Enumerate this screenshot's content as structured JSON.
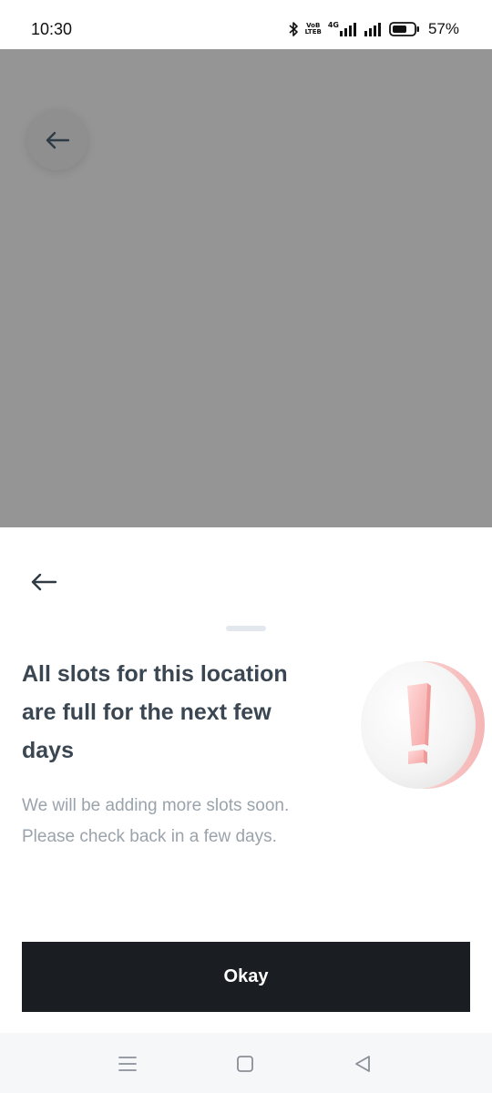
{
  "status_bar": {
    "time": "10:30",
    "battery": "57%",
    "network_label": "4G",
    "volte_top": "VoB",
    "volte_bottom": "LTEB",
    "icons": [
      "bluetooth-icon",
      "volte-icon",
      "signal-4g-icon",
      "signal-icon",
      "battery-icon"
    ]
  },
  "overlay": {
    "back_icon": "arrow-left-icon"
  },
  "sheet": {
    "back_icon": "arrow-left-icon",
    "title": "All slots for this location are full for the next few days",
    "subtitle": "We will be adding more slots soon. Please check back in a few days.",
    "illustration_icon": "exclamation-alert-icon",
    "okay_label": "Okay"
  },
  "nav_bar": {
    "icons": [
      "menu-icon",
      "home-icon",
      "back-triangle-icon"
    ]
  },
  "colors": {
    "overlay": "#959595",
    "button_bg": "#1a1e22",
    "title": "#3a4651",
    "subtitle": "#9aa3ab",
    "accent_pink": "#f8c8c8"
  }
}
